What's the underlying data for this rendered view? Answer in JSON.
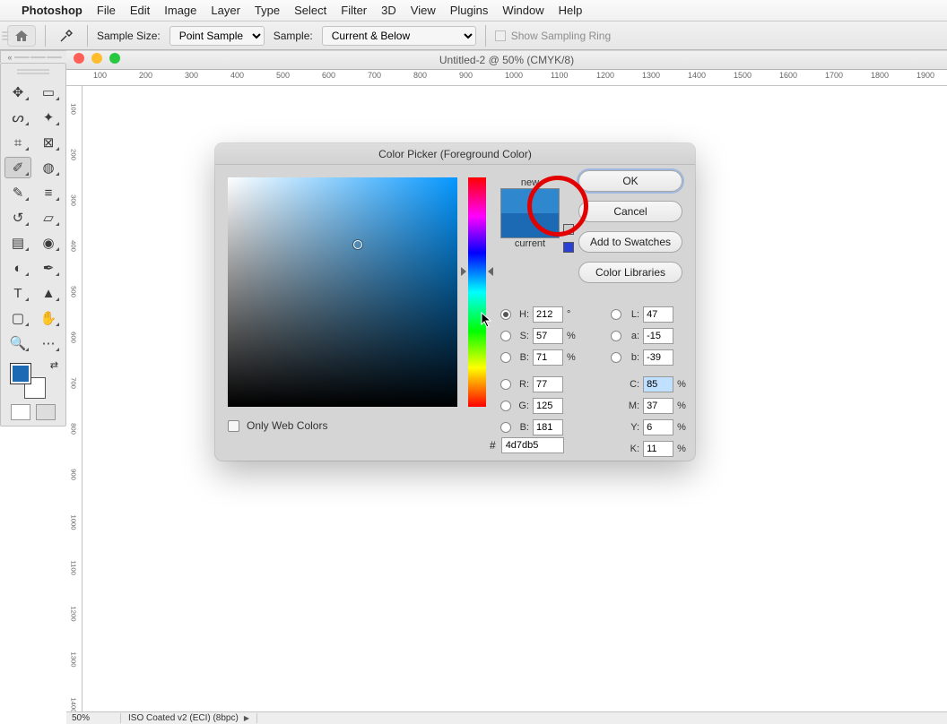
{
  "menubar": {
    "apple": "",
    "app": "Photoshop",
    "items": [
      "File",
      "Edit",
      "Image",
      "Layer",
      "Type",
      "Select",
      "Filter",
      "3D",
      "View",
      "Plugins",
      "Window",
      "Help"
    ]
  },
  "optbar": {
    "sample_size_label": "Sample Size:",
    "sample_size_value": "Point Sample",
    "sample_label": "Sample:",
    "sample_value": "Current & Below",
    "sampling_ring": "Show Sampling Ring"
  },
  "doc": {
    "title": "Untitled-2 @ 50% (CMYK/8)",
    "zoom": "50%",
    "profile": "ISO Coated v2 (ECI) (8bpc)"
  },
  "ruler_h": [
    "100",
    "200",
    "300",
    "400",
    "500",
    "600",
    "700",
    "800",
    "900",
    "1000",
    "1100",
    "1200",
    "1300",
    "1400",
    "1500",
    "1600",
    "1700",
    "1800",
    "1900"
  ],
  "ruler_v": [
    "100",
    "200",
    "300",
    "400",
    "500",
    "600",
    "700",
    "800",
    "900",
    "1000",
    "1100",
    "1200",
    "1300",
    "1400"
  ],
  "picker": {
    "title": "Color Picker (Foreground Color)",
    "new_label": "new",
    "current_label": "current",
    "buttons": {
      "ok": "OK",
      "cancel": "Cancel",
      "swatches": "Add to Swatches",
      "libraries": "Color Libraries"
    },
    "hsb": {
      "H": "212",
      "S": "57",
      "B": "71"
    },
    "lab": {
      "L": "47",
      "a": "-15",
      "b": "-39"
    },
    "rgb": {
      "R": "77",
      "G": "125",
      "B": "181"
    },
    "cmyk": {
      "C": "85",
      "M": "37",
      "Y": "6",
      "K": "11"
    },
    "hex_label": "#",
    "hex": "4d7db5",
    "degree": "°",
    "percent": "%",
    "webonly": "Only Web Colors",
    "labels": {
      "H": "H:",
      "S": "S:",
      "B": "B:",
      "L": "L:",
      "a": "a:",
      "b": "b:",
      "R": "R:",
      "G": "G:",
      "Bl": "B:",
      "C": "C:",
      "M": "M:",
      "Y": "Y:",
      "K": "K:"
    }
  },
  "tools": {
    "names": [
      "move-tool",
      "rect-marquee-tool",
      "lasso-tool",
      "magic-wand-tool",
      "crop-tool",
      "frame-tool",
      "eyedropper-tool",
      "healing-tool",
      "brush-tool",
      "clone-stamp-tool",
      "history-brush-tool",
      "eraser-tool",
      "gradient-tool",
      "blur-tool",
      "dodge-tool",
      "pen-tool",
      "type-tool",
      "path-select-tool",
      "rectangle-tool",
      "hand-tool",
      "zoom-tool",
      "edit-toolbar-tool"
    ],
    "selected_index": 6
  }
}
